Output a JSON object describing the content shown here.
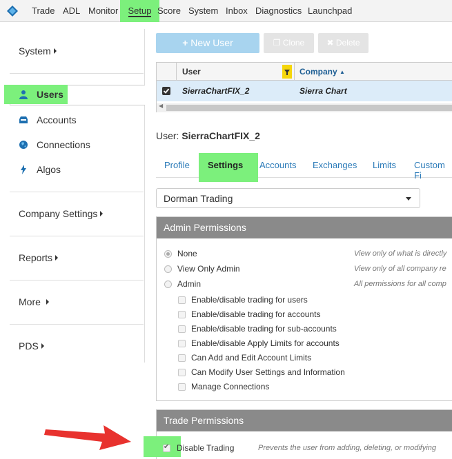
{
  "nav": {
    "items": [
      "Trade",
      "ADL",
      "Monitor",
      "Setup",
      "Score",
      "System",
      "Inbox",
      "Diagnostics",
      "Launchpad"
    ],
    "active": "Setup"
  },
  "sidebar": {
    "system_label": "System",
    "items": [
      {
        "label": "Users",
        "icon": "user-icon"
      },
      {
        "label": "Accounts",
        "icon": "inbox-icon"
      },
      {
        "label": "Connections",
        "icon": "globe-icon"
      },
      {
        "label": "Algos",
        "icon": "lightning-icon"
      }
    ],
    "company_settings_label": "Company Settings",
    "reports_label": "Reports",
    "more_label": "More",
    "pds_label": "PDS"
  },
  "toolbar": {
    "new_user_label": "New User",
    "clone_label": "Clone",
    "delete_label": "Delete"
  },
  "users_table": {
    "columns": [
      "User",
      "Company"
    ],
    "rows": [
      {
        "user": "SierraChartFIX_2",
        "company": "Sierra Chart",
        "checked": true
      }
    ]
  },
  "detail": {
    "user_prefix": "User:",
    "user_name": "SierraChartFIX_2",
    "tabs": [
      "Profile",
      "Settings",
      "Accounts",
      "Exchanges",
      "Limits",
      "Custom Fi"
    ],
    "active_tab": "Settings",
    "company_select": "Dorman Trading"
  },
  "admin_permissions": {
    "title": "Admin Permissions",
    "options": [
      {
        "label": "None",
        "desc": "View only of what is directly",
        "selected": true
      },
      {
        "label": "View Only Admin",
        "desc": "View only of all company re",
        "selected": false
      },
      {
        "label": "Admin",
        "desc": "All permissions for all comp",
        "selected": false
      }
    ],
    "checks": [
      "Enable/disable trading for users",
      "Enable/disable trading for accounts",
      "Enable/disable trading for sub-accounts",
      "Enable/disable Apply Limits for accounts",
      "Can Add and Edit Account Limits",
      "Can Modify User Settings and Information",
      "Manage Connections"
    ]
  },
  "trade_permissions": {
    "title": "Trade Permissions",
    "disable_trading_label": "Disable Trading",
    "disable_trading_checked": true,
    "disable_trading_desc": "Prevents the user from adding, deleting, or modifying"
  },
  "colors": {
    "highlight": "#7cf07c",
    "link": "#2a7ab8",
    "panel_header": "#8a8a8a",
    "selected_row": "#dcecf9",
    "annotation_arrow": "#e8322e"
  }
}
